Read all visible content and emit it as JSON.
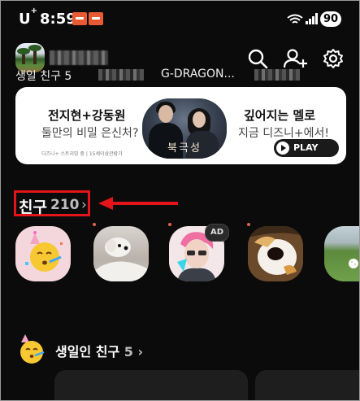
{
  "status_bar": {
    "carrier": "U",
    "carrier_mark": "+",
    "time": "8:59",
    "battery": "90"
  },
  "header": {
    "icons": [
      "search-icon",
      "add-friend-icon",
      "settings-icon"
    ]
  },
  "banner": {
    "title_left": "전지현+강동원",
    "subtitle_left": "둘만의 비밀 은신처?",
    "fine_print": "디즈니+ 스트리밍 중 | 15세이상관람가",
    "poster_title": "북극성",
    "title_right": "깊어지는 멜로",
    "subtitle_right": "지금 디즈니+에서!",
    "play_label": "PLAY"
  },
  "friends": {
    "label": "친구",
    "count": "210",
    "chevron": "›",
    "items": [
      {
        "name": "생일 친구 5",
        "badge": ""
      },
      {
        "name": "",
        "badge": ""
      },
      {
        "name": "G-DRAGON...",
        "badge": "AD"
      },
      {
        "name": "",
        "badge": ""
      },
      {
        "name": "",
        "badge": ""
      }
    ]
  },
  "birthday": {
    "label": "생일인 친구",
    "count": "5",
    "chevron": "›"
  },
  "colors": {
    "background": "#000000",
    "highlight_red": "#e3141a",
    "notification_orange": "#e85a33",
    "banner_bg": "#ffffff"
  }
}
